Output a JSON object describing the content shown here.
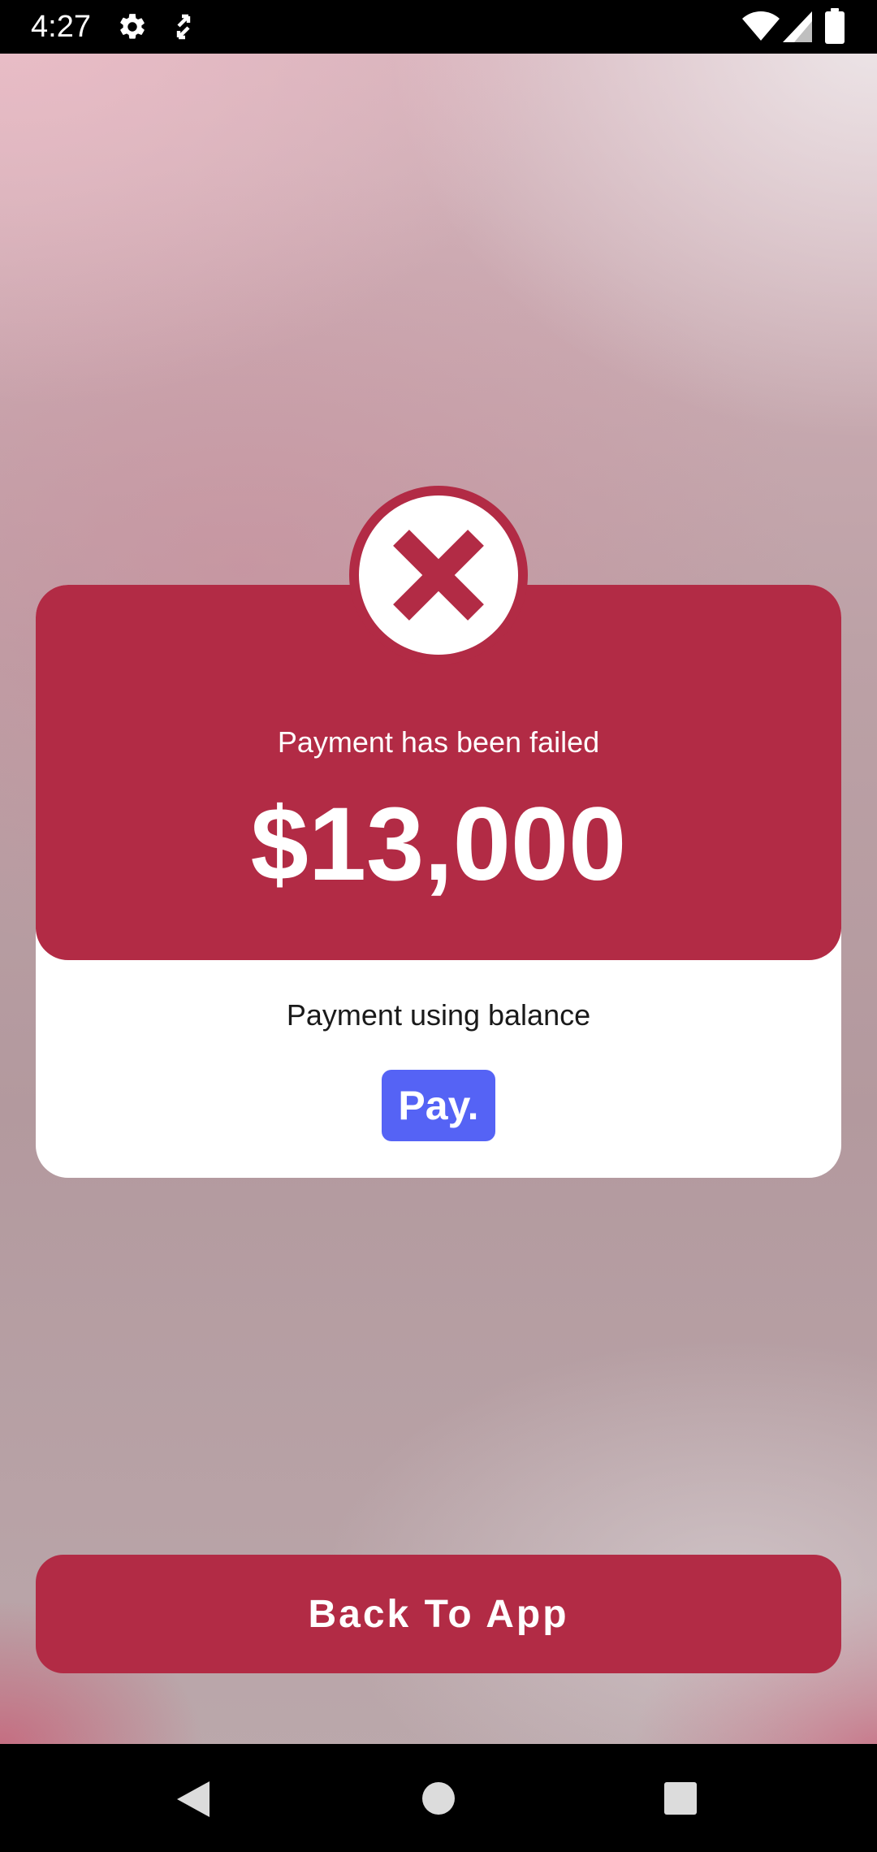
{
  "status_bar": {
    "time": "4:27",
    "icons": [
      "gear-icon",
      "screen-rotate-icon",
      "wifi-icon",
      "cell-signal-icon",
      "battery-icon"
    ]
  },
  "payment": {
    "status_message": "Payment has been failed",
    "amount": "$13,000",
    "method_label": "Payment using balance",
    "method_logo_text": "Pay.",
    "status_icon": "close-icon"
  },
  "actions": {
    "back_label": "Back To App"
  },
  "nav_bar": {
    "icons": [
      "back-icon",
      "home-icon",
      "recents-icon"
    ]
  },
  "colors": {
    "accent": "#b22b45",
    "pay_logo": "#5563f5",
    "card": "#ffffff"
  }
}
